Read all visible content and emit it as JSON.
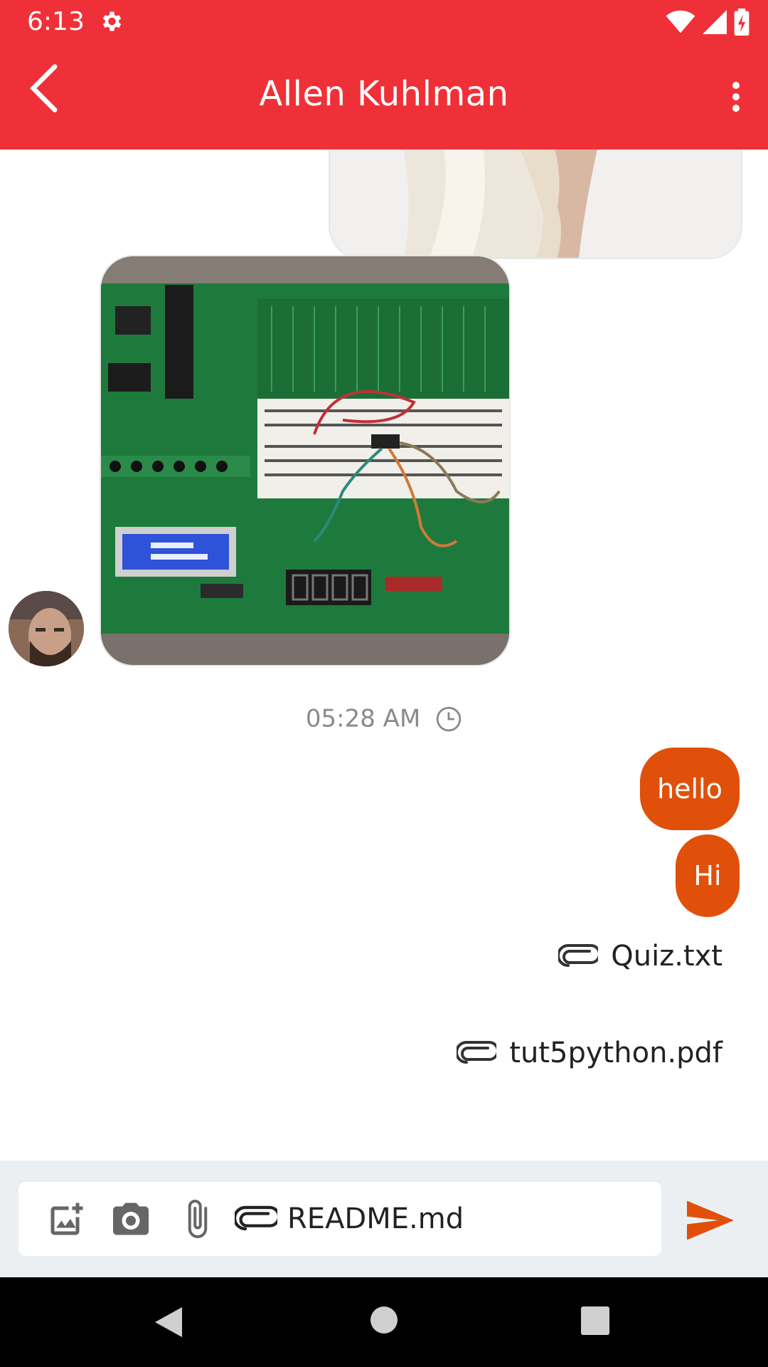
{
  "status_bar": {
    "time": "6:13"
  },
  "app_bar": {
    "title": "Allen Kuhlman"
  },
  "messages": {
    "timestamp": "05:28 AM",
    "bubbles": [
      "hello",
      "Hi"
    ],
    "files": [
      "Quiz.txt",
      "tut5python.pdf"
    ]
  },
  "composer": {
    "value": "README.md"
  },
  "colors": {
    "primary": "#f03038",
    "bubble": "#e0500a",
    "send": "#e0500a"
  }
}
